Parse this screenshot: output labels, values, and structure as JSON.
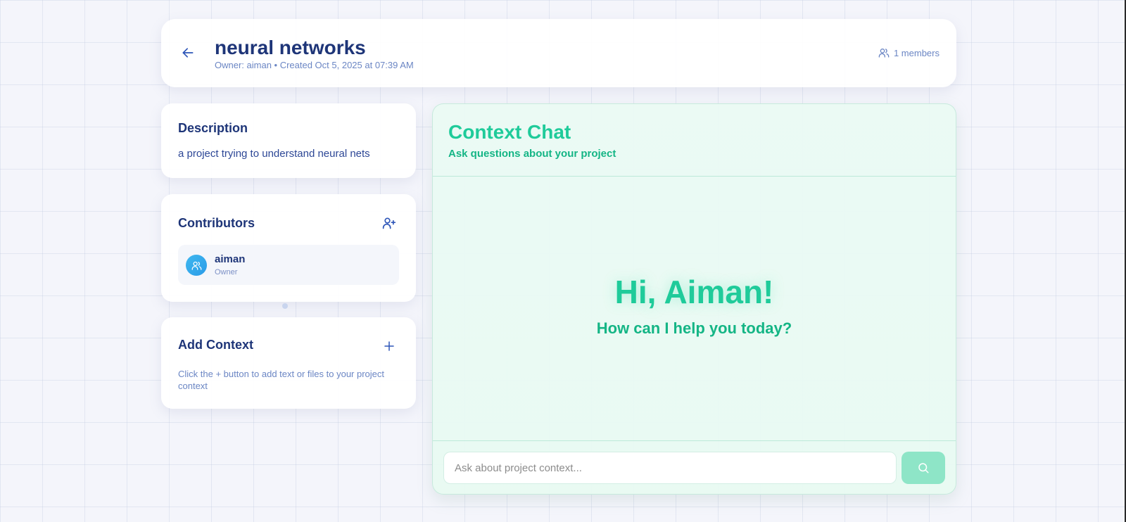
{
  "header": {
    "back_icon": "arrow-left-icon",
    "title": "neural networks",
    "subtitle": "Owner: aiman • Created Oct 5, 2025 at 07:39 AM",
    "members_icon": "users-icon",
    "members_label": "1 members"
  },
  "description": {
    "heading": "Description",
    "text": "a project trying to understand neural nets"
  },
  "contributors": {
    "heading": "Contributors",
    "add_icon": "user-plus-icon",
    "items": [
      {
        "name": "aiman",
        "role": "Owner",
        "avatar_icon": "users-icon"
      }
    ]
  },
  "add_context": {
    "heading": "Add Context",
    "add_icon": "plus-icon",
    "hint": "Click the + button to add text or files to your project context"
  },
  "chat": {
    "title": "Context Chat",
    "subtitle": "Ask questions about your project",
    "greeting": "Hi, Aiman!",
    "greeting_sub": "How can I help you today?",
    "input_value": "",
    "input_placeholder": "Ask about project context...",
    "send_icon": "search-icon"
  },
  "colors": {
    "primary_text": "#1e3578",
    "muted_text": "#6b86c4",
    "accent_green": "#1fcb9a",
    "send_button": "#8ee5c7",
    "avatar": "#2a9be8"
  }
}
